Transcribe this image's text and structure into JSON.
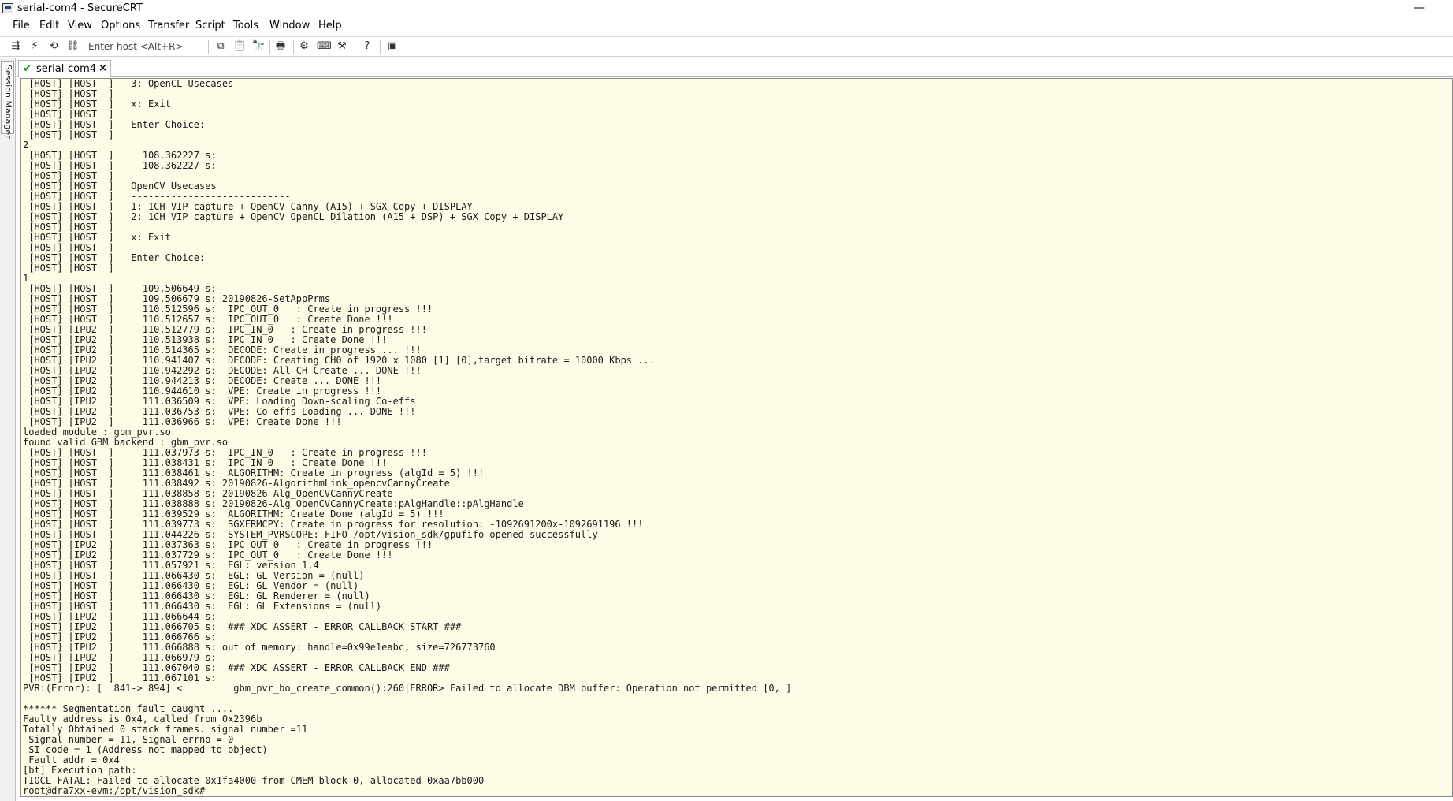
{
  "window": {
    "title": "serial-com4 - SecureCRT",
    "minimize_glyph": "—"
  },
  "menu": [
    "File",
    "Edit",
    "View",
    "Options",
    "Transfer",
    "Script",
    "Tools",
    "Window",
    "Help"
  ],
  "toolbar": {
    "host_placeholder": "Enter host <Alt+R>"
  },
  "tab": {
    "label": "serial-com4",
    "check_glyph": "✔",
    "close_glyph": "×"
  },
  "sidebar": {
    "label": "Session Manager"
  },
  "terminal": {
    "lines": [
      " [HOST] [HOST  ]   3: OpenCL Usecases",
      " [HOST] [HOST  ]",
      " [HOST] [HOST  ]   x: Exit",
      " [HOST] [HOST  ]",
      " [HOST] [HOST  ]   Enter Choice:",
      " [HOST] [HOST  ]",
      "2",
      " [HOST] [HOST  ]     108.362227 s:",
      " [HOST] [HOST  ]     108.362227 s:",
      " [HOST] [HOST  ]",
      " [HOST] [HOST  ]   OpenCV Usecases",
      " [HOST] [HOST  ]   ----------------------------",
      " [HOST] [HOST  ]   1: 1CH VIP capture + OpenCV Canny (A15) + SGX Copy + DISPLAY",
      " [HOST] [HOST  ]   2: 1CH VIP capture + OpenCV OpenCL Dilation (A15 + DSP) + SGX Copy + DISPLAY",
      " [HOST] [HOST  ]",
      " [HOST] [HOST  ]   x: Exit",
      " [HOST] [HOST  ]",
      " [HOST] [HOST  ]   Enter Choice:",
      " [HOST] [HOST  ]",
      "1",
      " [HOST] [HOST  ]     109.506649 s:",
      " [HOST] [HOST  ]     109.506679 s: 20190826-SetAppPrms",
      " [HOST] [HOST  ]     110.512596 s:  IPC_OUT_0   : Create in progress !!!",
      " [HOST] [HOST  ]     110.512657 s:  IPC_OUT_0   : Create Done !!!",
      " [HOST] [IPU2  ]     110.512779 s:  IPC_IN_0   : Create in progress !!!",
      " [HOST] [IPU2  ]     110.513938 s:  IPC_IN_0   : Create Done !!!",
      " [HOST] [IPU2  ]     110.514365 s:  DECODE: Create in progress ... !!!",
      " [HOST] [IPU2  ]     110.941407 s:  DECODE: Creating CH0 of 1920 x 1080 [1] [0],target bitrate = 10000 Kbps ...",
      " [HOST] [IPU2  ]     110.942292 s:  DECODE: All CH Create ... DONE !!!",
      " [HOST] [IPU2  ]     110.944213 s:  DECODE: Create ... DONE !!!",
      " [HOST] [IPU2  ]     110.944610 s:  VPE: Create in progress !!!",
      " [HOST] [IPU2  ]     111.036509 s:  VPE: Loading Down-scaling Co-effs",
      " [HOST] [IPU2  ]     111.036753 s:  VPE: Co-effs Loading ... DONE !!!",
      " [HOST] [IPU2  ]     111.036966 s:  VPE: Create Done !!!",
      "loaded module : gbm_pvr.so",
      "found valid GBM backend : gbm_pvr.so",
      " [HOST] [HOST  ]     111.037973 s:  IPC_IN_0   : Create in progress !!!",
      " [HOST] [HOST  ]     111.038431 s:  IPC_IN_0   : Create Done !!!",
      " [HOST] [HOST  ]     111.038461 s:  ALGORITHM: Create in progress (algId = 5) !!!",
      " [HOST] [HOST  ]     111.038492 s: 20190826-AlgorithmLink_opencvCannyCreate",
      " [HOST] [HOST  ]     111.038858 s: 20190826-Alg_OpenCVCannyCreate",
      " [HOST] [HOST  ]     111.038888 s: 20190826-Alg_OpenCVCannyCreate:pAlgHandle::pAlgHandle",
      " [HOST] [HOST  ]     111.039529 s:  ALGORITHM: Create Done (algId = 5) !!!",
      " [HOST] [HOST  ]     111.039773 s:  SGXFRMCPY: Create in progress for resolution: -1092691200x-1092691196 !!!",
      " [HOST] [HOST  ]     111.044226 s:  SYSTEM_PVRSCOPE: FIFO /opt/vision_sdk/gpufifo opened successfully",
      " [HOST] [IPU2  ]     111.037363 s:  IPC_OUT_0   : Create in progress !!!",
      " [HOST] [IPU2  ]     111.037729 s:  IPC_OUT_0   : Create Done !!!",
      " [HOST] [HOST  ]     111.057921 s:  EGL: version 1.4",
      " [HOST] [HOST  ]     111.066430 s:  EGL: GL Version = (null)",
      " [HOST] [HOST  ]     111.066430 s:  EGL: GL Vendor = (null)",
      " [HOST] [HOST  ]     111.066430 s:  EGL: GL Renderer = (null)",
      " [HOST] [HOST  ]     111.066430 s:  EGL: GL Extensions = (null)",
      " [HOST] [IPU2  ]     111.066644 s:",
      " [HOST] [IPU2  ]     111.066705 s:  ### XDC ASSERT - ERROR CALLBACK START ###",
      " [HOST] [IPU2  ]     111.066766 s:",
      " [HOST] [IPU2  ]     111.066888 s: out of memory: handle=0x99e1eabc, size=726773760",
      " [HOST] [IPU2  ]     111.066979 s:",
      " [HOST] [IPU2  ]     111.067040 s:  ### XDC ASSERT - ERROR CALLBACK END ###",
      " [HOST] [IPU2  ]     111.067101 s:",
      "PVR:(Error): [  841-> 894] <         gbm_pvr_bo_create_common():260|ERROR> Failed to allocate DBM buffer: Operation not permitted [0, ]",
      "",
      "****** Segmentation fault caught ....",
      "Faulty address is 0x4, called from 0x2396b",
      "Totally Obtained 0 stack frames. signal number =11",
      " Signal number = 11, Signal errno = 0",
      " SI code = 1 (Address not mapped to object)",
      " Fault addr = 0x4",
      "[bt] Execution path:",
      "TIOCL FATAL: Failed to allocate 0x1fa4000 from CMEM block 0, allocated 0xaa7bb000",
      "root@dra7xx-evm:/opt/vision_sdk#"
    ]
  }
}
